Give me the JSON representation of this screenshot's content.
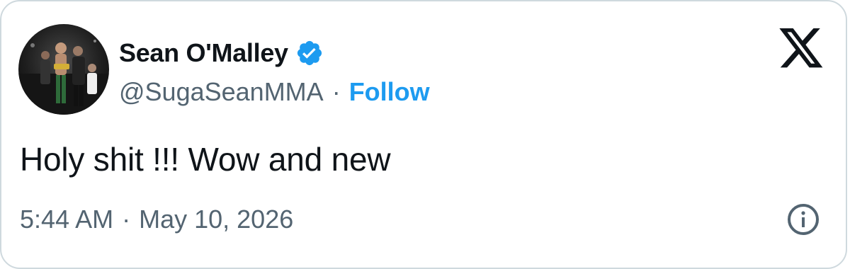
{
  "tweet": {
    "author": {
      "display_name": "Sean O'Malley",
      "handle": "@SugaSeanMMA",
      "verified": true,
      "avatar_icon": "avatar-photo"
    },
    "separator": "·",
    "follow_label": "Follow",
    "text": "Holy shit !!! Wow and new",
    "time": "5:44 AM",
    "date": "May 10, 2026"
  },
  "icons": {
    "verified": "verified-badge-icon",
    "brand": "x-logo-icon",
    "info": "info-icon"
  },
  "colors": {
    "accent": "#1d9bf0",
    "text_primary": "#0f1419",
    "text_secondary": "#536471",
    "border": "#cfd9de"
  }
}
